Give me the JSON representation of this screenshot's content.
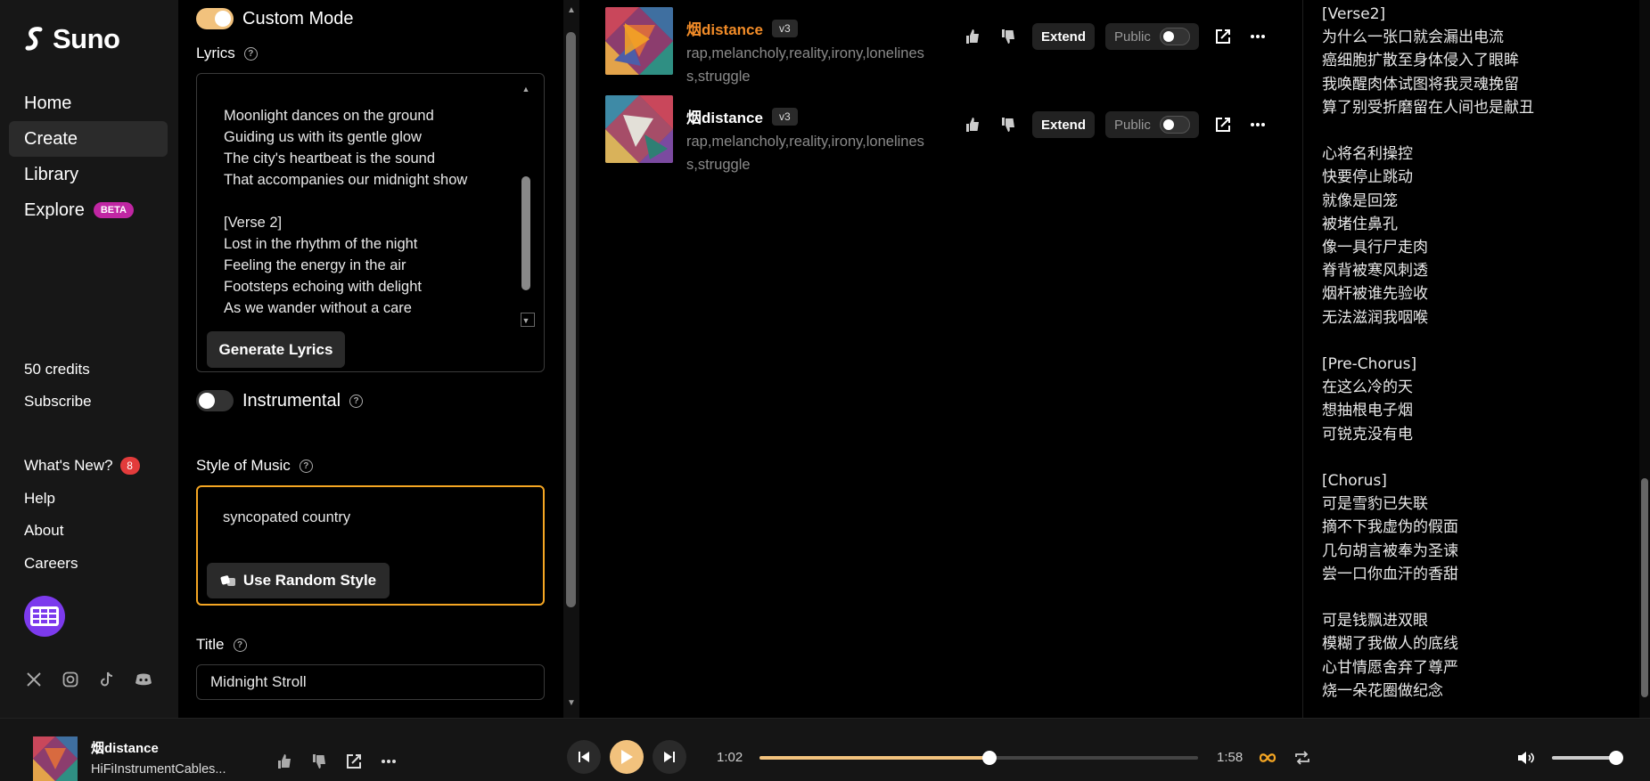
{
  "brand": {
    "name": "Suno"
  },
  "nav": [
    {
      "label": "Home"
    },
    {
      "label": "Create",
      "active": true
    },
    {
      "label": "Library"
    },
    {
      "label": "Explore",
      "badge": "BETA"
    }
  ],
  "account": {
    "credits": "50 credits",
    "subscribe": "Subscribe"
  },
  "links": [
    {
      "label": "What's New?",
      "badge": "8"
    },
    {
      "label": "Help"
    },
    {
      "label": "About"
    },
    {
      "label": "Careers"
    }
  ],
  "social_icons": [
    "x-icon",
    "instagram-icon",
    "tiktok-icon",
    "discord-icon"
  ],
  "create": {
    "custom_mode_label": "Custom Mode",
    "custom_mode_on": true,
    "lyrics_label": "Lyrics",
    "lyrics_text": "Moonlight dances on the ground\nGuiding us with its gentle glow\nThe city's heartbeat is the sound\nThat accompanies our midnight show\n\n[Verse 2]\nLost in the rhythm of the night\nFeeling the energy in the air\nFootsteps echoing with delight\nAs we wander without a care",
    "generate_lyrics_label": "Generate Lyrics",
    "instrumental_label": "Instrumental",
    "instrumental_on": false,
    "style_label": "Style of Music",
    "style_value": "syncopated country",
    "random_style_label": "Use Random Style",
    "title_label": "Title",
    "title_value": "Midnight Stroll"
  },
  "songs": [
    {
      "title": "烟distance",
      "version": "v3",
      "tags": "rap,melancholy,reality,irony,loneliness,struggle",
      "extend_label": "Extend",
      "public_label": "Public",
      "playing": true
    },
    {
      "title": "烟distance",
      "version": "v3",
      "tags": "rap,melancholy,reality,irony,loneliness,struggle",
      "extend_label": "Extend",
      "public_label": "Public",
      "playing": false
    }
  ],
  "right_lyrics": "[Verse2]\n为什么一张口就会漏出电流\n癌细胞扩散至身体侵入了眼眸\n我唤醒肉体试图将我灵魂挽留\n算了别受折磨留在人间也是献丑\n\n心将名利操控\n快要停止跳动\n就像是回笼\n被堵住鼻孔\n像一具行尸走肉\n脊背被寒风刺透\n烟杆被谁先验收\n无法滋润我咽喉\n\n[Pre-Chorus]\n在这么冷的天\n想抽根电子烟\n可锐克没有电\n\n[Chorus]\n可是雪豹已失联\n摘不下我虚伪的假面\n几句胡言被奉为圣谏\n尝一口你血汗的香甜\n\n可是钱飘进双眼\n模糊了我做人的底线\n心甘情愿舍弃了尊严\n烧一朵花圈做纪念",
  "player": {
    "title": "烟distance",
    "artist": "HiFiInstrumentCables...",
    "current_time": "1:02",
    "duration": "1:58",
    "progress": 0.525,
    "volume": 1.0,
    "accent": "#f2c27d"
  }
}
